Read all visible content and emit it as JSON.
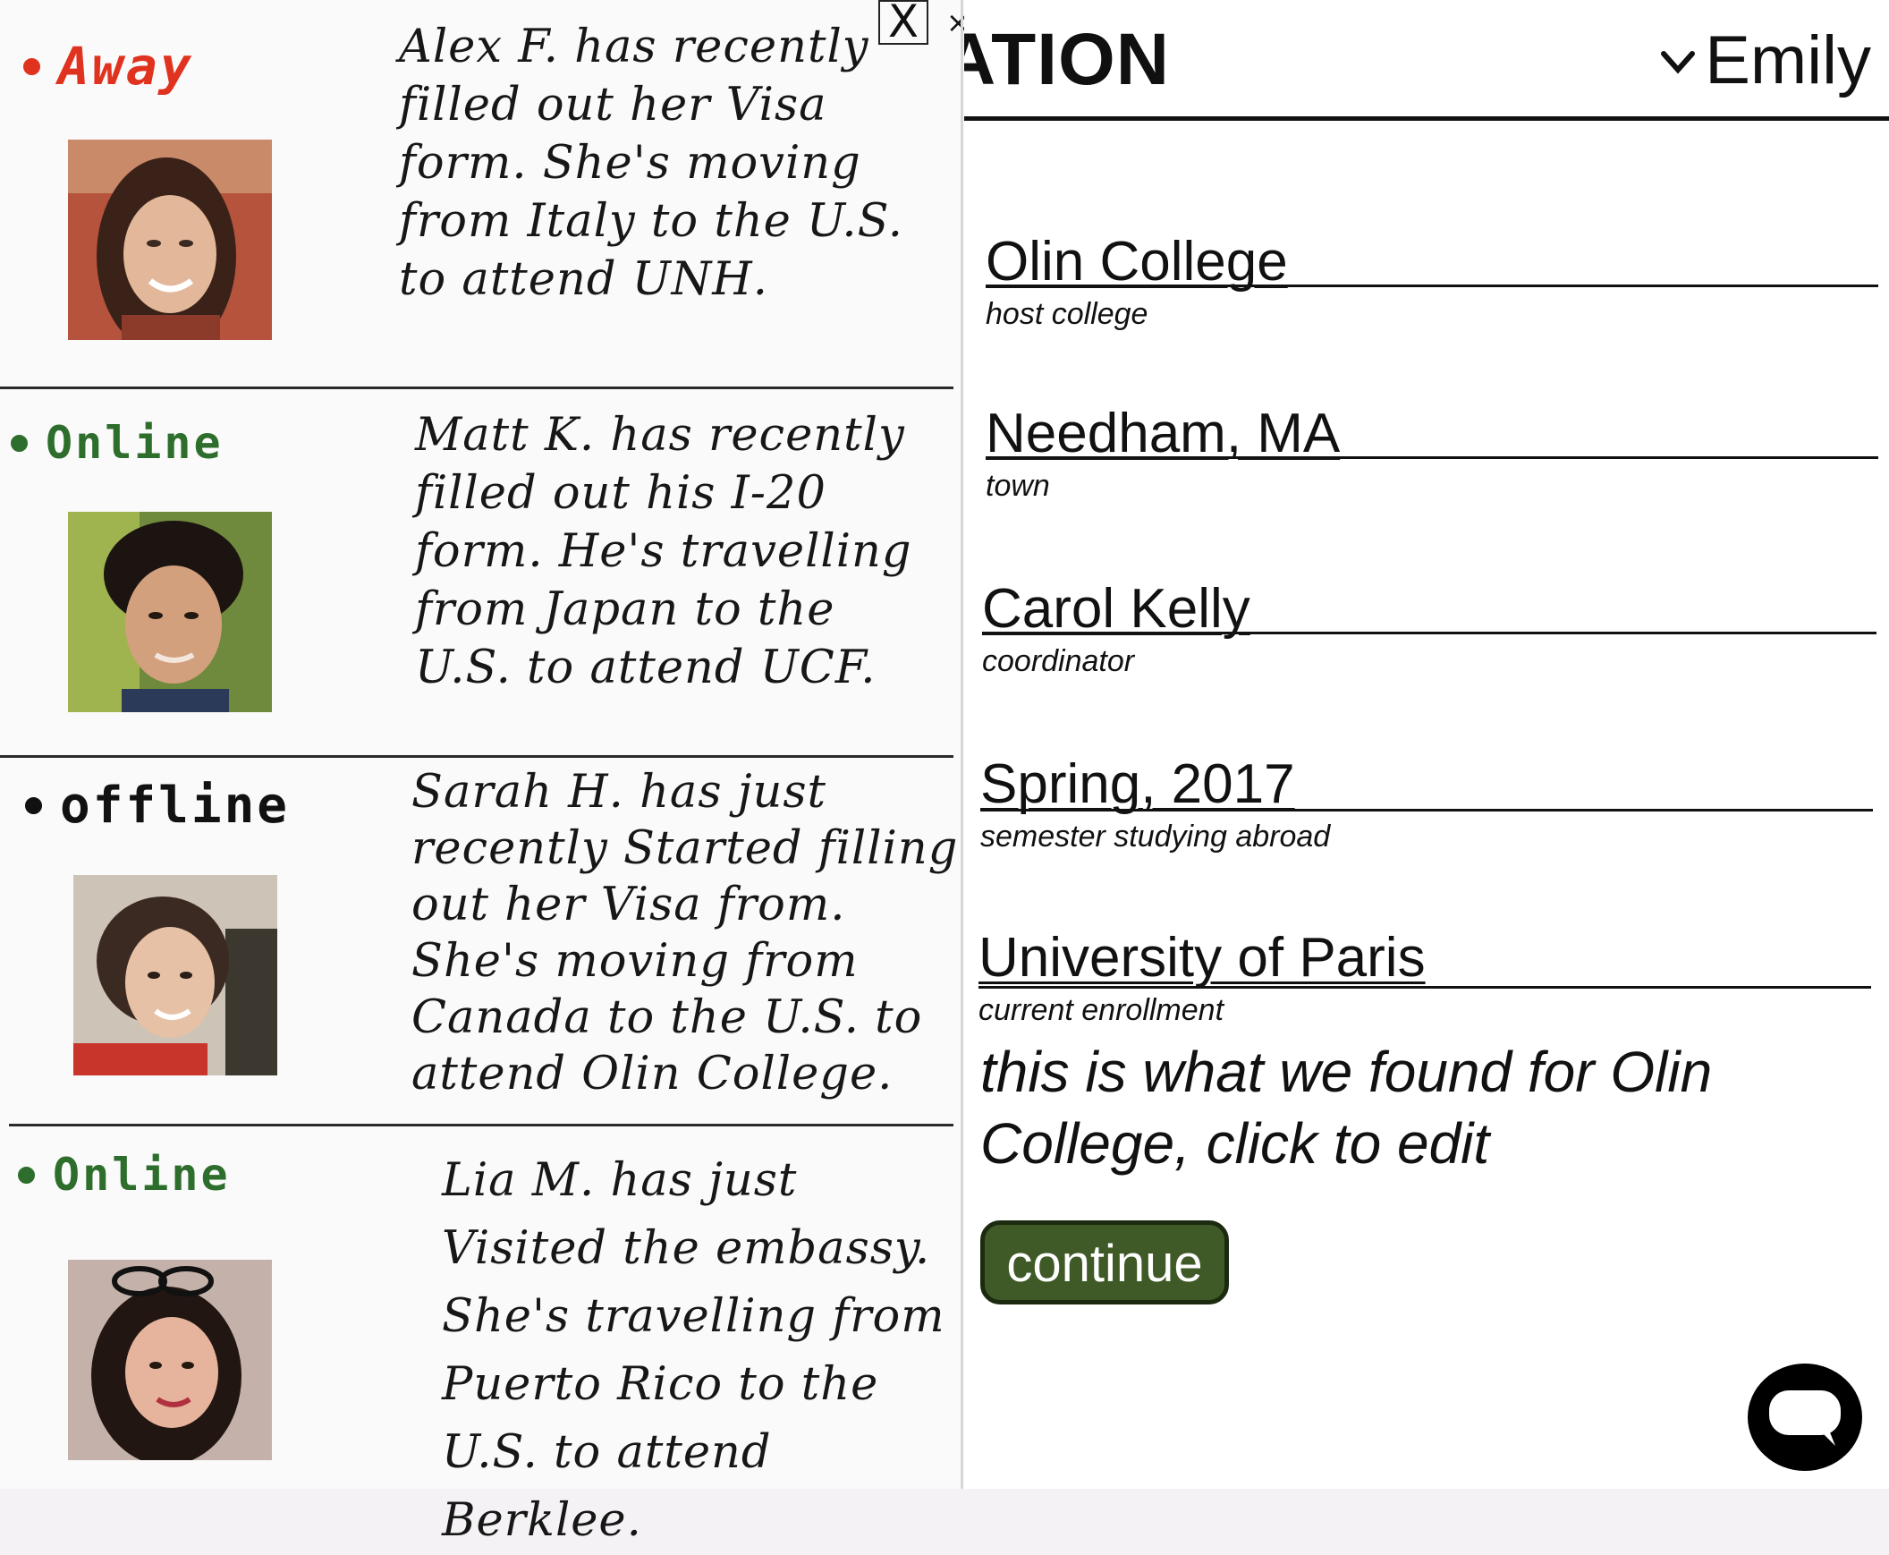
{
  "activity": {
    "items": [
      {
        "status": "Away",
        "status_color": "#e0331f",
        "text": "Alex F. has recently\nfilled out her Visa\nform. She's moving\nfrom Italy to the U.S.\nto attend UNH."
      },
      {
        "status": "Online",
        "status_color": "#2e6e2c",
        "text": "Matt K. has recently\nfilled out his I-20\nform. He's travelling\nfrom Japan to the\nU.S. to attend UCF."
      },
      {
        "status": "offline",
        "status_color": "#111111",
        "text": "Sarah H. has just\nrecently Started filling\nout her Visa from.\nShe's moving from\nCanada to the U.S. to\nattend Olin College."
      },
      {
        "status": "Online",
        "status_color": "#2e6e2c",
        "text": "Lia M. has just\nVisited the embassy.\nShe's travelling from\nPuerto Rico to the\nU.S. to attend Berklee."
      }
    ],
    "close_box": "X",
    "close_small": "×"
  },
  "header": {
    "title": "ATION",
    "user_name": "Emily"
  },
  "form": {
    "fields": [
      {
        "value": "Olin College",
        "caption": "host college"
      },
      {
        "value": "Needham, MA",
        "caption": "town"
      },
      {
        "value": "Carol Kelly",
        "caption": "coordinator"
      },
      {
        "value": "Spring, 2017",
        "caption": "semester studying abroad"
      },
      {
        "value": "University of Paris",
        "caption": "current enrollment"
      }
    ],
    "found_message": "this is what we found for Olin College, click to edit",
    "continue_label": "continue"
  },
  "colors": {
    "continue_bg": "#3f5a26",
    "chat_icon": "#000000"
  },
  "icons": {
    "user_menu": "chevron-down-icon",
    "chat": "chat-bubble-icon",
    "close": "close-icon"
  }
}
